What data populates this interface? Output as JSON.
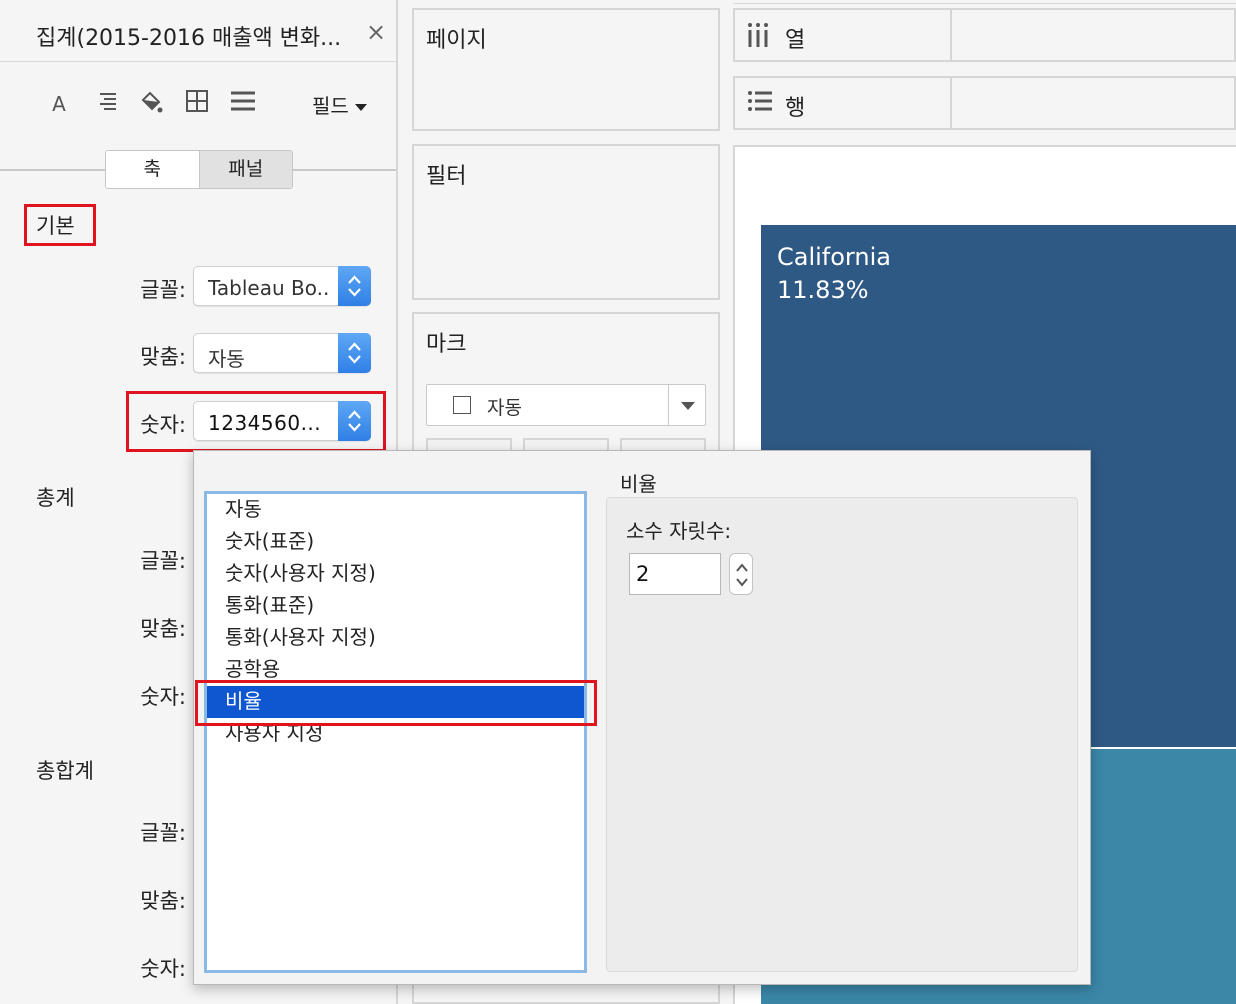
{
  "pane": {
    "title": "집계(2015-2016 매출액 변화...",
    "close": "×",
    "field_label": "필드",
    "tabs": {
      "axis": "축",
      "pane": "패널"
    },
    "sections": {
      "basic": "기본",
      "total": "총계",
      "grand_total": "총합계"
    },
    "labels": {
      "font": "글꼴:",
      "align": "맞춤:",
      "number": "숫자:"
    },
    "basic_font_value": "Tableau Bo..",
    "basic_align_value": "자동",
    "basic_number_value": "1234560...",
    "toolbar_icons": [
      "font-icon",
      "align-icon",
      "shading-icon",
      "borders-icon",
      "lines-icon"
    ]
  },
  "shelves": {
    "pages": "페이지",
    "filters": "필터",
    "marks": "마크",
    "marks_type": "자동",
    "columns": "열",
    "rows": "행"
  },
  "view": {
    "tile1_state": "California",
    "tile1_pct": "11.83%",
    "colors": {
      "tile1": "#2f5985",
      "tile2": "#3a87a8"
    }
  },
  "format_popup": {
    "items": [
      "자동",
      "숫자(표준)",
      "숫자(사용자 지정)",
      "통화(표준)",
      "통화(사용자 지정)",
      "공학용",
      "비율",
      "사용자 지정"
    ],
    "selected": "비율",
    "detail_title": "비율",
    "decimals_label": "소수 자릿수:",
    "decimals_value": "2",
    "selection_color": "#0f57d0"
  }
}
